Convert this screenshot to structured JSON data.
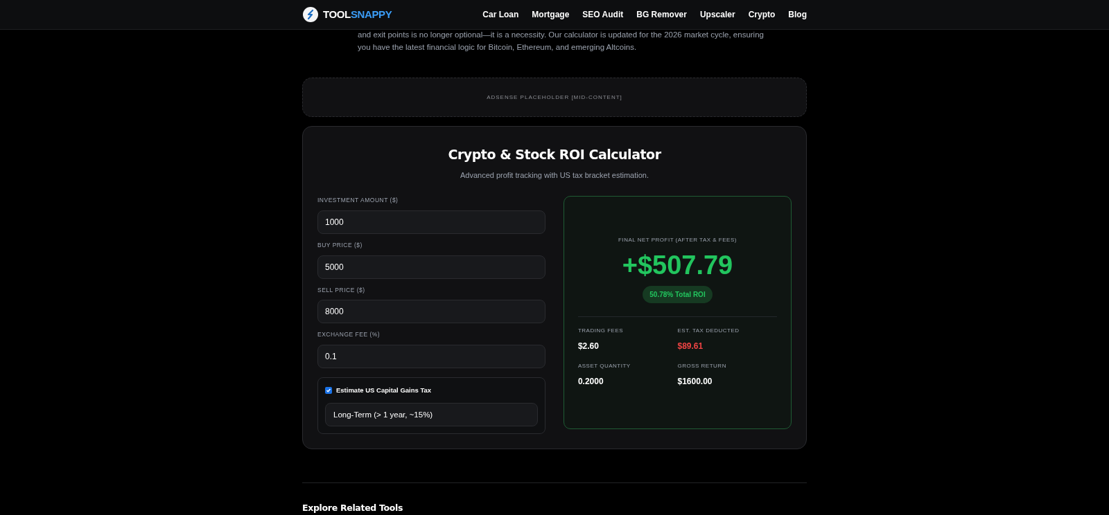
{
  "header": {
    "logo": {
      "part1": "TOOL",
      "part2": "SNAPPY"
    },
    "nav": [
      "Car Loan",
      "Mortgage",
      "SEO Audit",
      "BG Remover",
      "Upscaler",
      "Crypto",
      "Blog"
    ]
  },
  "intro": {
    "lines": [
      "and exit points is no longer optional—it is a necessity. Our calculator is updated for the 2026 market cycle, ensuring",
      "you have the latest financial logic for Bitcoin, Ethereum, and emerging Altcoins."
    ]
  },
  "ad": {
    "text": "ADSENSE PLACEHOLDER [MID-CONTENT]"
  },
  "calculator": {
    "title": "Crypto & Stock ROI Calculator",
    "subtitle": "Advanced profit tracking with US tax bracket estimation.",
    "fields": [
      {
        "label": "INVESTMENT AMOUNT ($)",
        "value": "1000"
      },
      {
        "label": "BUY PRICE ($)",
        "value": "5000"
      },
      {
        "label": "SELL PRICE ($)",
        "value": "8000"
      },
      {
        "label": "EXCHANGE FEE (%)",
        "value": "0.1"
      }
    ],
    "tax": {
      "label": "Estimate US Capital Gains Tax",
      "checked": true,
      "select": "Long-Term (> 1 year, ~15%)"
    },
    "result": {
      "label": "FINAL NET PROFIT (AFTER TAX & FEES)",
      "value": "+$507.79",
      "roi": "50.78% Total ROI",
      "stats": [
        {
          "label": "TRADING FEES",
          "value": "$2.60",
          "kind": "plain"
        },
        {
          "label": "EST. TAX DEDUCTED",
          "value": "$89.61",
          "kind": "loss"
        },
        {
          "label": "ASSET QUANTITY",
          "value": "0.2000",
          "kind": "plain"
        },
        {
          "label": "GROSS RETURN",
          "value": "$1600.00",
          "kind": "plain"
        }
      ]
    }
  },
  "related": {
    "title": "Explore Related Tools"
  }
}
